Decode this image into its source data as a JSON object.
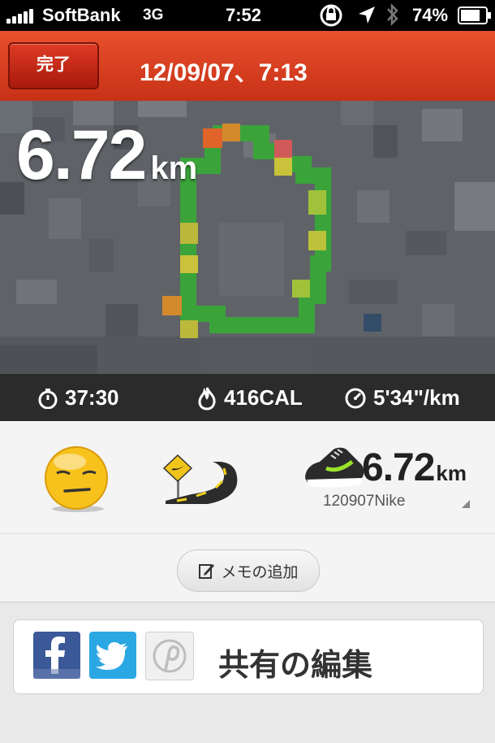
{
  "status_bar": {
    "carrier": "SoftBank",
    "network": "3G",
    "time": "7:52",
    "battery": "74%"
  },
  "header": {
    "done_label": "完了",
    "datetime": "12/09/07、7:13"
  },
  "run": {
    "distance": "6.72",
    "distance_unit": "km",
    "duration": "37:30",
    "calories": "416CAL",
    "pace": "5'34\"/km"
  },
  "shoe": {
    "distance": "6.72",
    "unit": "km",
    "name": "120907Nike"
  },
  "memo": {
    "label": "メモの追加"
  },
  "share": {
    "label": "共有の編集",
    "services": [
      "facebook",
      "twitter",
      "pinterest"
    ]
  },
  "icons": {
    "mood": "meh-face-icon",
    "terrain": "road-icon",
    "duration": "stopwatch-icon",
    "calories": "flame-icon",
    "pace": "speedometer-icon"
  },
  "colors": {
    "header": "#d9401f",
    "route_fast": "#3aa43a",
    "route_mid": "#c9c23a",
    "route_slow": "#e0642a",
    "facebook": "#3b5998",
    "twitter": "#2ba7e3"
  }
}
